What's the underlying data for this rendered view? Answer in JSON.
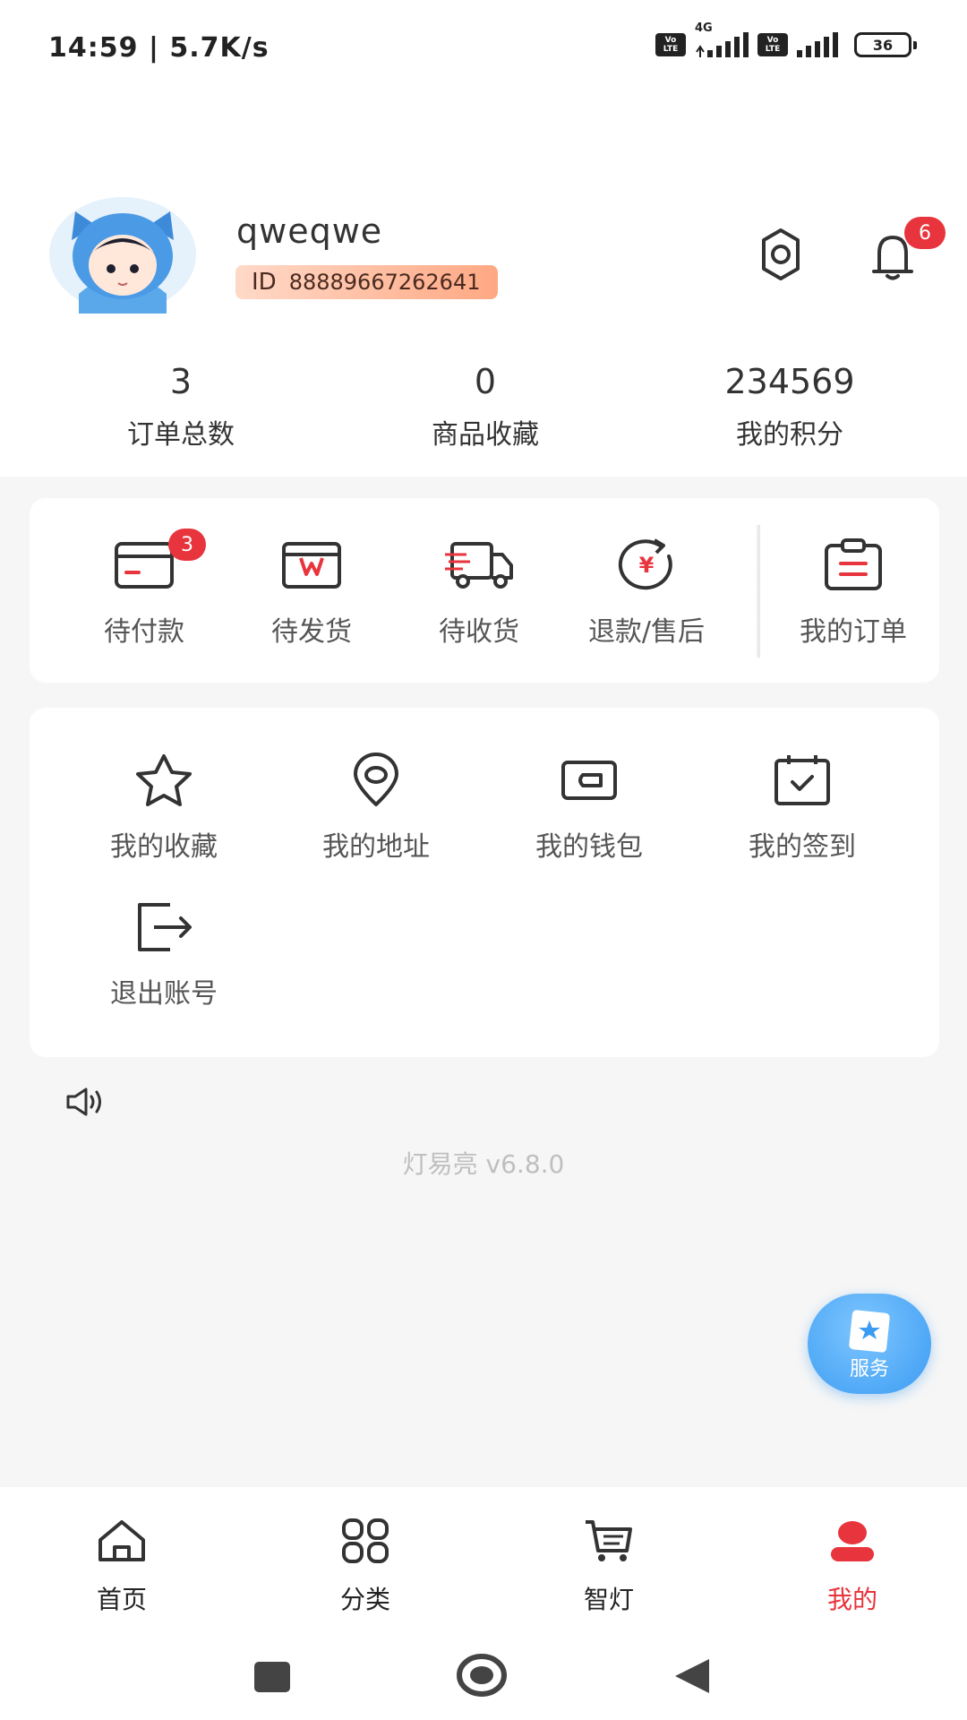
{
  "status_bar": {
    "time": "14:59 | 5.7K/s",
    "volte_top": "Vo",
    "volte_bottom": "LTE",
    "network": "4G",
    "battery": "36"
  },
  "profile": {
    "username": "qweqwe",
    "id_label": "ID",
    "id_value": "88889667262641",
    "notification_count": "6"
  },
  "stats": [
    {
      "value": "3",
      "label": "订单总数"
    },
    {
      "value": "0",
      "label": "商品收藏"
    },
    {
      "value": "234569",
      "label": "我的积分"
    }
  ],
  "orders": {
    "items": [
      {
        "label": "待付款",
        "icon": "card-icon",
        "badge": "3"
      },
      {
        "label": "待发货",
        "icon": "package-icon"
      },
      {
        "label": "待收货",
        "icon": "truck-icon"
      },
      {
        "label": "退款/售后",
        "icon": "refund-icon"
      }
    ],
    "my_orders": {
      "label": "我的订单",
      "icon": "clipboard-icon"
    }
  },
  "services": {
    "items": [
      {
        "label": "我的收藏",
        "icon": "star-icon"
      },
      {
        "label": "我的地址",
        "icon": "location-icon"
      },
      {
        "label": "我的钱包",
        "icon": "wallet-icon"
      },
      {
        "label": "我的签到",
        "icon": "calendar-check-icon"
      },
      {
        "label": "退出账号",
        "icon": "logout-icon"
      }
    ]
  },
  "version": "灯易亮 v6.8.0",
  "float_service_label": "服务",
  "tabbar": {
    "items": [
      {
        "label": "首页",
        "icon": "home-icon"
      },
      {
        "label": "分类",
        "icon": "grid-icon"
      },
      {
        "label": "智灯",
        "icon": "cart-icon"
      },
      {
        "label": "我的",
        "icon": "person-icon",
        "active": true
      }
    ]
  },
  "colors": {
    "accent_red": "#e8343c",
    "service_blue": "#3c9cf2",
    "id_badge_start": "#ffd9c8",
    "id_badge_end": "#ffa883",
    "background": "#f6f6f6"
  }
}
